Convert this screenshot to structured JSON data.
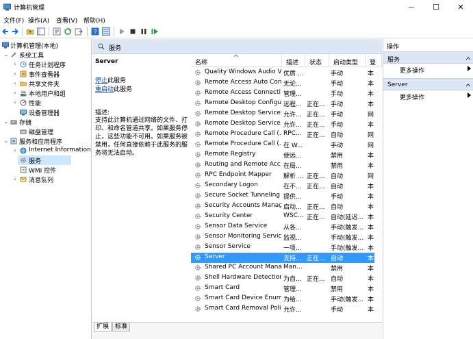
{
  "window": {
    "title": "计算机管理",
    "controls": {
      "minimize": "—",
      "maximize": "☐",
      "close": "✕"
    }
  },
  "menu": {
    "items": [
      "文件(F)",
      "操作(A)",
      "查看(V)",
      "帮助(H)"
    ]
  },
  "toolbar": {
    "icons": [
      "back-icon",
      "forward-icon",
      "folder-up-icon",
      "show-tree-icon",
      "properties-icon",
      "refresh-icon",
      "export-icon",
      "help-icon",
      "details-view-icon",
      "play-icon",
      "stop-icon",
      "pause-icon",
      "restart-icon"
    ]
  },
  "tree": {
    "root": "计算机管理(本地)",
    "system_tools": "系统工具",
    "task_scheduler": "任务计划程序",
    "event_viewer": "事件查看器",
    "shared_folders": "共享文件夹",
    "local_users": "本地用户和组",
    "performance": "性能",
    "device_manager": "设备管理器",
    "storage": "存储",
    "disk_management": "磁盘管理",
    "services_apps": "服务和应用程序",
    "iis": "Internet Information S",
    "services": "服务",
    "wmi": "WMI 控件",
    "message_queue": "消息队列"
  },
  "services_panel": {
    "header": "服务",
    "selected_name": "Server",
    "stop_link": "停止",
    "stop_suffix": "此服务",
    "restart_link": "重启动",
    "restart_suffix": "此服务",
    "desc_label": "描述:",
    "desc_text": "支持此计算机通过网络的文件、打印、和命名管道共享。如果服务停止，这些功能不可用。如果服务被禁用，任何直接依赖于此服务的服务将无法启动。"
  },
  "columns": {
    "name": "名称",
    "description": "描述",
    "status": "状态",
    "startup": "启动类型",
    "logon": "登"
  },
  "services": [
    {
      "name": "Quality Windows Audio V...",
      "desc": "优质 ...",
      "status": "",
      "startup": "手动",
      "logon": "本"
    },
    {
      "name": "Remote Access Auto Con...",
      "desc": "无论...",
      "status": "",
      "startup": "手动",
      "logon": "本"
    },
    {
      "name": "Remote Access Connecti...",
      "desc": "管理...",
      "status": "",
      "startup": "手动",
      "logon": "本"
    },
    {
      "name": "Remote Desktop Configu...",
      "desc": "远程...",
      "status": "正在...",
      "startup": "手动",
      "logon": "本"
    },
    {
      "name": "Remote Desktop Services",
      "desc": "允许...",
      "status": "正在...",
      "startup": "手动",
      "logon": "网"
    },
    {
      "name": "Remote Desktop Service...",
      "desc": "允许...",
      "status": "正在...",
      "startup": "手动",
      "logon": "本"
    },
    {
      "name": "Remote Procedure Call (...",
      "desc": "RPC...",
      "status": "正在...",
      "startup": "自动",
      "logon": "网"
    },
    {
      "name": "Remote Procedure Call (...",
      "desc": "在 W...",
      "status": "",
      "startup": "手动",
      "logon": "网"
    },
    {
      "name": "Remote Registry",
      "desc": "使远...",
      "status": "",
      "startup": "禁用",
      "logon": "本"
    },
    {
      "name": "Routing and Remote Acc...",
      "desc": "在局...",
      "status": "",
      "startup": "禁用",
      "logon": "本"
    },
    {
      "name": "RPC Endpoint Mapper",
      "desc": "解析 ...",
      "status": "正在...",
      "startup": "自动",
      "logon": "网"
    },
    {
      "name": "Secondary Logon",
      "desc": "在不...",
      "status": "正在...",
      "startup": "自动",
      "logon": "本"
    },
    {
      "name": "Secure Socket Tunneling ...",
      "desc": "提供...",
      "status": "",
      "startup": "手动",
      "logon": "本"
    },
    {
      "name": "Security Accounts Manag...",
      "desc": "启动...",
      "status": "正在...",
      "startup": "自动",
      "logon": "本"
    },
    {
      "name": "Security Center",
      "desc": "WSC...",
      "status": "正在...",
      "startup": "自动(延迟...",
      "logon": "本"
    },
    {
      "name": "Sensor Data Service",
      "desc": "从各...",
      "status": "",
      "startup": "手动(触发...",
      "logon": "本"
    },
    {
      "name": "Sensor Monitoring Service",
      "desc": "监视...",
      "status": "",
      "startup": "手动(触发...",
      "logon": "本"
    },
    {
      "name": "Sensor Service",
      "desc": "一项...",
      "status": "",
      "startup": "手动(触发...",
      "logon": "本"
    },
    {
      "name": "Server",
      "desc": "支持...",
      "status": "正在...",
      "startup": "自动",
      "logon": "本"
    },
    {
      "name": "Shared PC Account Mana...",
      "desc": "Man...",
      "status": "",
      "startup": "禁用",
      "logon": "本"
    },
    {
      "name": "Shell Hardware Detection",
      "desc": "为自...",
      "status": "正在...",
      "startup": "自动",
      "logon": "本"
    },
    {
      "name": "Smart Card",
      "desc": "管理...",
      "status": "",
      "startup": "禁用",
      "logon": "本"
    },
    {
      "name": "Smart Card Device Enum...",
      "desc": "为给...",
      "status": "",
      "startup": "手动(触发...",
      "logon": "本"
    },
    {
      "name": "Smart Card Removal Poli...",
      "desc": "允许...",
      "status": "",
      "startup": "手动",
      "logon": "本"
    }
  ],
  "selected_index": 18,
  "tabs": [
    "扩展",
    "标准"
  ],
  "actions": {
    "title": "操作",
    "section1": "服务",
    "section1_more": "更多操作",
    "section2": "Server",
    "section2_more": "更多操作"
  },
  "colors": {
    "selection": "#3399ff",
    "header_bg": "#dce6f4",
    "tree_selection": "#cce8ff"
  }
}
